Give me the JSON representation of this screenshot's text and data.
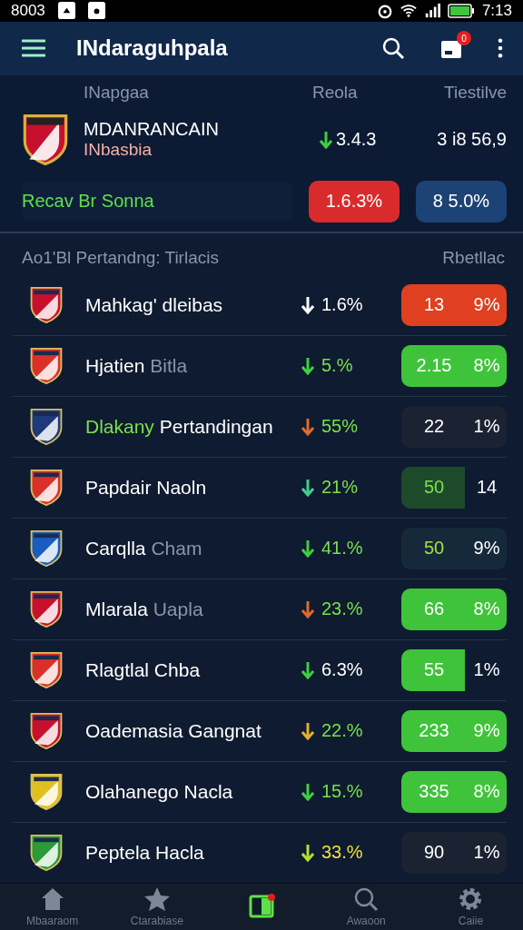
{
  "status_bar": {
    "carrier": "8003",
    "time": "7:13"
  },
  "app_bar": {
    "title": "INdaraguhpala",
    "notification_count": "0"
  },
  "summary": {
    "columns": [
      "INapgaa",
      "Reola",
      "Tiestilve"
    ],
    "team": "MDANRANCAIN",
    "subtitle": "INbasbia",
    "value": "3.4.3",
    "total": "3 i8 56,9",
    "note": "Recav Br Sonna",
    "badges": [
      {
        "text": "1.6.3%",
        "kind": "loss"
      },
      {
        "text": "8 5.0%",
        "kind": "neutral"
      }
    ]
  },
  "section": {
    "title": "Ao1'Bl Pertandng: Tirlacis",
    "right": "Rbetllac"
  },
  "rows": [
    {
      "name": [
        {
          "text": "Mahkag' dleibas",
          "color": "#ffffff"
        }
      ],
      "color": "#c8102e",
      "arrow": {
        "color": "#ffffff"
      },
      "change": {
        "text": "1.6%",
        "color": "#ffffff"
      },
      "badge": {
        "kind": "loss",
        "value": "13",
        "pct": "9%"
      }
    },
    {
      "name": [
        {
          "text": "Hjatien",
          "color": "#ffffff"
        },
        {
          "text": "Bitla",
          "color": "#8a96a8"
        }
      ],
      "color": "#d9302a",
      "arrow": {
        "color": "#3ecf3e"
      },
      "change": {
        "text": "5.%",
        "color": "#7ae04a"
      },
      "badge": {
        "kind": "gain",
        "value": "2.15",
        "pct": "8%"
      }
    },
    {
      "name": [
        {
          "text": "Dlakany",
          "color": "#7ae04a"
        },
        {
          "text": "Pertandingan",
          "color": "#ffffff"
        }
      ],
      "color": "#1e3a7a",
      "arrow": {
        "color": "#e06a2a"
      },
      "change": {
        "text": "55%",
        "color": "#7ae04a"
      },
      "badge": {
        "kind": "flat",
        "value": "22",
        "pct": "1%"
      }
    },
    {
      "name": [
        {
          "text": "Papdair Naoln",
          "color": "#ffffff"
        }
      ],
      "color": "#d9302a",
      "arrow": {
        "color": "#3ecf8a"
      },
      "change": {
        "text": "21%",
        "color": "#7ae04a"
      },
      "badge": {
        "kind": "partial",
        "value": "50",
        "pct": "14"
      }
    },
    {
      "name": [
        {
          "text": "Carqlla",
          "color": "#ffffff"
        },
        {
          "text": "Cham",
          "color": "#8a96a8"
        }
      ],
      "color": "#1a5cc0",
      "arrow": {
        "color": "#3ecf3e"
      },
      "change": {
        "text": "41.%",
        "color": "#7ae04a"
      },
      "badge": {
        "kind": "muted",
        "value": "50",
        "pct": "9%"
      }
    },
    {
      "name": [
        {
          "text": "Mlarala",
          "color": "#ffffff"
        },
        {
          "text": "Uapla",
          "color": "#8a96a8"
        }
      ],
      "color": "#c8102e",
      "arrow": {
        "color": "#e06a2a"
      },
      "change": {
        "text": "23.%",
        "color": "#7ae04a"
      },
      "badge": {
        "kind": "gain",
        "value": "66",
        "pct": "8%"
      }
    },
    {
      "name": [
        {
          "text": "Rlagtlal Chba",
          "color": "#ffffff"
        }
      ],
      "color": "#d9302a",
      "arrow": {
        "color": "#3ecf3e"
      },
      "change": {
        "text": "6.3%",
        "color": "#ffffff"
      },
      "badge": {
        "kind": "half",
        "value": "55",
        "pct": "1%"
      }
    },
    {
      "name": [
        {
          "text": "Oademasia Gangnat",
          "color": "#ffffff"
        }
      ],
      "color": "#c8102e",
      "arrow": {
        "color": "#e0b030"
      },
      "change": {
        "text": "22.%",
        "color": "#7ae04a"
      },
      "badge": {
        "kind": "gain",
        "value": "233",
        "pct": "9%"
      }
    },
    {
      "name": [
        {
          "text": "Olahanego Nacla",
          "color": "#ffffff"
        }
      ],
      "color": "#e0c020",
      "arrow": {
        "color": "#3ecf3e"
      },
      "change": {
        "text": "15.%",
        "color": "#7ae04a"
      },
      "badge": {
        "kind": "gain",
        "value": "335",
        "pct": "8%"
      }
    },
    {
      "name": [
        {
          "text": "Peptela Hacla",
          "color": "#ffffff"
        }
      ],
      "color": "#2a9a3a",
      "arrow": {
        "color": "#b0e030"
      },
      "change": {
        "text": "33.%",
        "color": "#f0e040"
      },
      "badge": {
        "kind": "flat",
        "value": "90",
        "pct": "1%"
      }
    }
  ],
  "nav": [
    {
      "label": "Mbaaraom",
      "kind": "home",
      "selected": false
    },
    {
      "label": "Ctarabiase",
      "kind": "star",
      "selected": false
    },
    {
      "kind": "board",
      "selected": true
    },
    {
      "label": "Awaoon",
      "kind": "search",
      "selected": false
    },
    {
      "label": "Caiie",
      "kind": "gear",
      "selected": false
    }
  ]
}
